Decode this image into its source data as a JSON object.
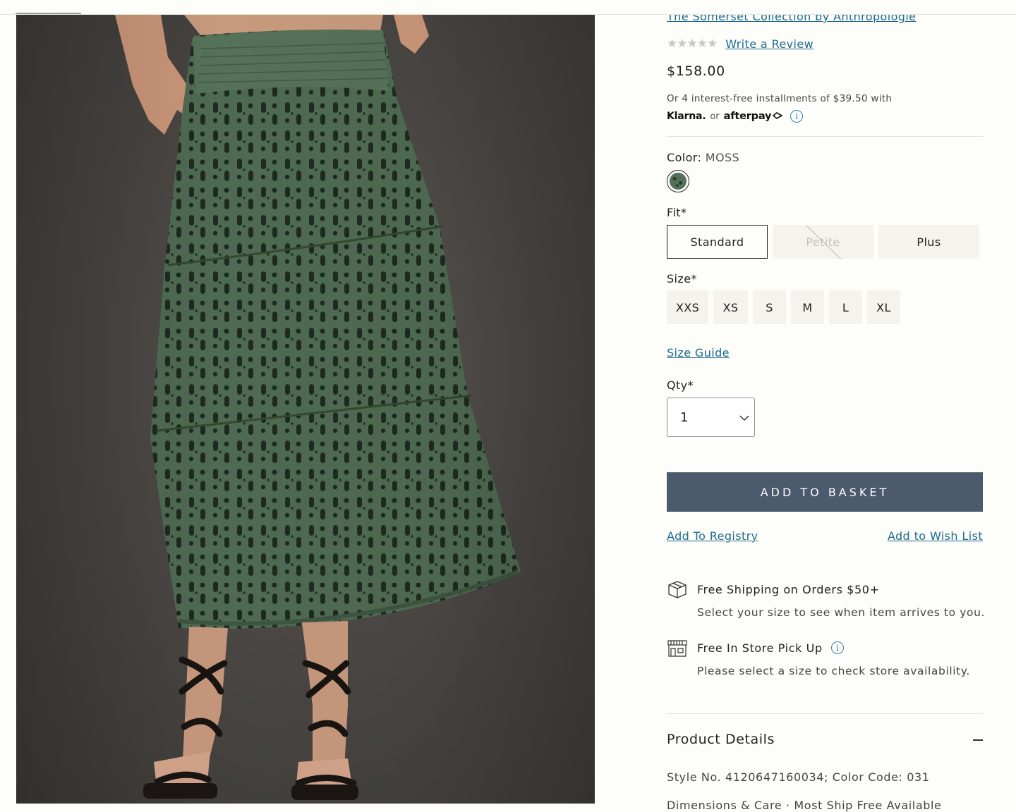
{
  "product": {
    "brand_link": "The Somerset Collection by Anthropologie",
    "stars": "★★★★★",
    "write_review": "Write a Review",
    "price": "$158.00",
    "installments": "Or 4 interest-free installments of $39.50 with",
    "klarna": "Klarna.",
    "or": "or",
    "afterpay": "afterpay",
    "info_glyph": "i"
  },
  "color": {
    "label": "Color:",
    "value": "MOSS",
    "swatch_hex": "#55705a"
  },
  "fit": {
    "label": "Fit*",
    "options": [
      {
        "label": "Standard",
        "state": "selected"
      },
      {
        "label": "Petite",
        "state": "disabled"
      },
      {
        "label": "Plus",
        "state": "available"
      }
    ]
  },
  "size": {
    "label": "Size*",
    "options": [
      "XXS",
      "XS",
      "S",
      "M",
      "L",
      "XL"
    ]
  },
  "size_guide": "Size Guide",
  "qty": {
    "label": "Qty*",
    "value": "1"
  },
  "add_to_basket": "ADD TO BASKET",
  "add_to_registry": "Add To Registry",
  "add_to_wishlist": "Add to Wish List",
  "shipping": {
    "title": "Free Shipping on Orders $50+",
    "subtitle": "Select your size to see when item arrives to you."
  },
  "pickup": {
    "title": "Free In Store Pick Up",
    "subtitle": "Please select a size to check store availability."
  },
  "product_details": {
    "title": "Product Details",
    "style_line": "Style No. 4120647160034; Color Code: 031",
    "cut_line": "Dimensions & Care  ·  Most Ship Free Available"
  },
  "colors": {
    "link": "#1d6a8e",
    "button": "#4c5a6e",
    "skirt": "#4f6a52"
  }
}
